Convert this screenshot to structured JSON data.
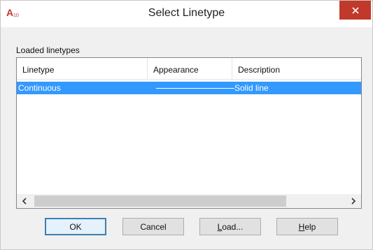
{
  "window": {
    "title": "Select Linetype",
    "app_icon_text": "A10",
    "accent_color": "#3399ff",
    "close_color": "#c0392b"
  },
  "group": {
    "label": "Loaded linetypes"
  },
  "table": {
    "columns": [
      "Linetype",
      "Appearance",
      "Description"
    ],
    "rows": [
      {
        "linetype": "Continuous",
        "appearance": "solid-line-sample",
        "description": "Solid line",
        "selected": true
      }
    ]
  },
  "scrollbar": {
    "left_icon": "chevron-left-icon",
    "right_icon": "chevron-right-icon"
  },
  "buttons": {
    "ok": "OK",
    "cancel": "Cancel",
    "load_mnemonic": "L",
    "load_rest": "oad...",
    "help_mnemonic": "H",
    "help_rest": "elp"
  }
}
